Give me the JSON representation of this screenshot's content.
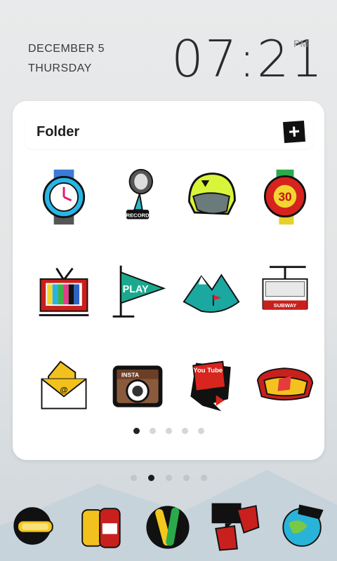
{
  "statusbar": {
    "date": "DECEMBER 5",
    "weekday": "THURSDAY",
    "time": "07:21",
    "ampm": "PM"
  },
  "folder": {
    "title": "Folder",
    "add_label": "+",
    "pages": 5,
    "active_page": 0,
    "apps": [
      {
        "icon": "watch-icon"
      },
      {
        "icon": "microphone-icon",
        "label": "RECORD"
      },
      {
        "icon": "helmet-icon"
      },
      {
        "icon": "calendar-watch-icon",
        "label": "30"
      },
      {
        "icon": "tv-icon"
      },
      {
        "icon": "play-flag-icon",
        "label": "PLAY"
      },
      {
        "icon": "mountain-flag-icon"
      },
      {
        "icon": "subway-lift-icon",
        "label": "SUBWAY"
      },
      {
        "icon": "mail-icon"
      },
      {
        "icon": "instagram-icon",
        "label": "INSTA"
      },
      {
        "icon": "youtube-icon",
        "label": "You Tube"
      },
      {
        "icon": "goggles-icon"
      }
    ]
  },
  "home_pager": {
    "pages": 5,
    "active_page": 1
  },
  "dock": [
    {
      "icon": "skier-avatar-icon"
    },
    {
      "icon": "backpack-icon"
    },
    {
      "icon": "snowboards-icon"
    },
    {
      "icon": "chat-gloves-icon"
    },
    {
      "icon": "globe-hat-icon"
    }
  ]
}
